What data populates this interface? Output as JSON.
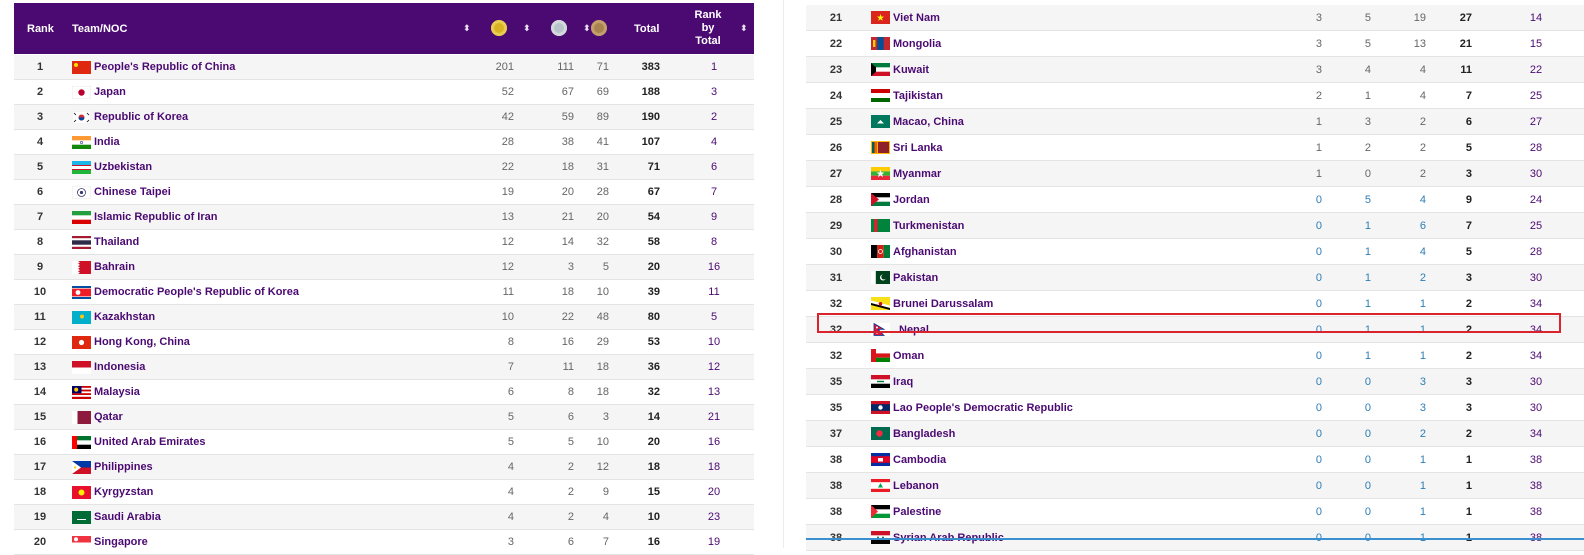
{
  "header": {
    "rank": "Rank",
    "team": "Team/NOC",
    "total": "Total",
    "rank_by_total": [
      "Rank",
      "by",
      "Total"
    ],
    "sort_glyph": "⬍"
  },
  "colors": {
    "header_bg": "#4b0a72",
    "team_text": "#4b0a72",
    "highlight": "#d9232d",
    "zero_medal": "#2d7db4"
  },
  "left_rows": [
    {
      "rank": "1",
      "team": "People's Republic of China",
      "flag": "china",
      "g": "201",
      "s": "111",
      "b": "71",
      "total": "383",
      "rbt": "1"
    },
    {
      "rank": "2",
      "team": "Japan",
      "flag": "japan",
      "g": "52",
      "s": "67",
      "b": "69",
      "total": "188",
      "rbt": "3"
    },
    {
      "rank": "3",
      "team": "Republic of Korea",
      "flag": "korea",
      "g": "42",
      "s": "59",
      "b": "89",
      "total": "190",
      "rbt": "2"
    },
    {
      "rank": "4",
      "team": "India",
      "flag": "india",
      "g": "28",
      "s": "38",
      "b": "41",
      "total": "107",
      "rbt": "4"
    },
    {
      "rank": "5",
      "team": "Uzbekistan",
      "flag": "uzbekistan",
      "g": "22",
      "s": "18",
      "b": "31",
      "total": "71",
      "rbt": "6"
    },
    {
      "rank": "6",
      "team": "Chinese Taipei",
      "flag": "taipei",
      "g": "19",
      "s": "20",
      "b": "28",
      "total": "67",
      "rbt": "7"
    },
    {
      "rank": "7",
      "team": "Islamic Republic of Iran",
      "flag": "iran",
      "g": "13",
      "s": "21",
      "b": "20",
      "total": "54",
      "rbt": "9"
    },
    {
      "rank": "8",
      "team": "Thailand",
      "flag": "thailand",
      "g": "12",
      "s": "14",
      "b": "32",
      "total": "58",
      "rbt": "8"
    },
    {
      "rank": "9",
      "team": "Bahrain",
      "flag": "bahrain",
      "g": "12",
      "s": "3",
      "b": "5",
      "total": "20",
      "rbt": "16"
    },
    {
      "rank": "10",
      "team": "Democratic People's Republic of Korea",
      "flag": "dprk",
      "g": "11",
      "s": "18",
      "b": "10",
      "total": "39",
      "rbt": "11"
    },
    {
      "rank": "11",
      "team": "Kazakhstan",
      "flag": "kazakhstan",
      "g": "10",
      "s": "22",
      "b": "48",
      "total": "80",
      "rbt": "5"
    },
    {
      "rank": "12",
      "team": "Hong Kong, China",
      "flag": "hongkong",
      "g": "8",
      "s": "16",
      "b": "29",
      "total": "53",
      "rbt": "10"
    },
    {
      "rank": "13",
      "team": "Indonesia",
      "flag": "indonesia",
      "g": "7",
      "s": "11",
      "b": "18",
      "total": "36",
      "rbt": "12"
    },
    {
      "rank": "14",
      "team": "Malaysia",
      "flag": "malaysia",
      "g": "6",
      "s": "8",
      "b": "18",
      "total": "32",
      "rbt": "13"
    },
    {
      "rank": "15",
      "team": "Qatar",
      "flag": "qatar",
      "g": "5",
      "s": "6",
      "b": "3",
      "total": "14",
      "rbt": "21"
    },
    {
      "rank": "16",
      "team": "United Arab Emirates",
      "flag": "uae",
      "g": "5",
      "s": "5",
      "b": "10",
      "total": "20",
      "rbt": "16"
    },
    {
      "rank": "17",
      "team": "Philippines",
      "flag": "philippines",
      "g": "4",
      "s": "2",
      "b": "12",
      "total": "18",
      "rbt": "18"
    },
    {
      "rank": "18",
      "team": "Kyrgyzstan",
      "flag": "kyrgyzstan",
      "g": "4",
      "s": "2",
      "b": "9",
      "total": "15",
      "rbt": "20"
    },
    {
      "rank": "19",
      "team": "Saudi Arabia",
      "flag": "saudi",
      "g": "4",
      "s": "2",
      "b": "4",
      "total": "10",
      "rbt": "23"
    },
    {
      "rank": "20",
      "team": "Singapore",
      "flag": "singapore",
      "g": "3",
      "s": "6",
      "b": "7",
      "total": "16",
      "rbt": "19"
    }
  ],
  "right_rows": [
    {
      "rank": "21",
      "team": "Viet Nam",
      "flag": "vietnam",
      "g": "3",
      "s": "5",
      "b": "19",
      "total": "27",
      "rbt": "14"
    },
    {
      "rank": "22",
      "team": "Mongolia",
      "flag": "mongolia",
      "g": "3",
      "s": "5",
      "b": "13",
      "total": "21",
      "rbt": "15"
    },
    {
      "rank": "23",
      "team": "Kuwait",
      "flag": "kuwait",
      "g": "3",
      "s": "4",
      "b": "4",
      "total": "11",
      "rbt": "22"
    },
    {
      "rank": "24",
      "team": "Tajikistan",
      "flag": "tajikistan",
      "g": "2",
      "s": "1",
      "b": "4",
      "total": "7",
      "rbt": "25"
    },
    {
      "rank": "25",
      "team": "Macao, China",
      "flag": "macao",
      "g": "1",
      "s": "3",
      "b": "2",
      "total": "6",
      "rbt": "27"
    },
    {
      "rank": "26",
      "team": "Sri Lanka",
      "flag": "srilanka",
      "g": "1",
      "s": "2",
      "b": "2",
      "total": "5",
      "rbt": "28"
    },
    {
      "rank": "27",
      "team": "Myanmar",
      "flag": "myanmar",
      "g": "1",
      "s": "0",
      "b": "2",
      "total": "3",
      "rbt": "30"
    },
    {
      "rank": "28",
      "team": "Jordan",
      "flag": "jordan",
      "g": "0",
      "s": "5",
      "b": "4",
      "total": "9",
      "rbt": "24"
    },
    {
      "rank": "29",
      "team": "Turkmenistan",
      "flag": "turkmenistan",
      "g": "0",
      "s": "1",
      "b": "6",
      "total": "7",
      "rbt": "25"
    },
    {
      "rank": "30",
      "team": "Afghanistan",
      "flag": "afghanistan",
      "g": "0",
      "s": "1",
      "b": "4",
      "total": "5",
      "rbt": "28"
    },
    {
      "rank": "31",
      "team": "Pakistan",
      "flag": "pakistan",
      "g": "0",
      "s": "1",
      "b": "2",
      "total": "3",
      "rbt": "30"
    },
    {
      "rank": "32",
      "team": "Brunei Darussalam",
      "flag": "brunei",
      "g": "0",
      "s": "1",
      "b": "1",
      "total": "2",
      "rbt": "34"
    },
    {
      "rank": "32",
      "team": "Nepal",
      "flag": "nepal",
      "g": "0",
      "s": "1",
      "b": "1",
      "total": "2",
      "rbt": "34",
      "highlighted": true
    },
    {
      "rank": "32",
      "team": "Oman",
      "flag": "oman",
      "g": "0",
      "s": "1",
      "b": "1",
      "total": "2",
      "rbt": "34"
    },
    {
      "rank": "35",
      "team": "Iraq",
      "flag": "iraq",
      "g": "0",
      "s": "0",
      "b": "3",
      "total": "3",
      "rbt": "30"
    },
    {
      "rank": "35",
      "team": "Lao People's Democratic Republic",
      "flag": "laos",
      "g": "0",
      "s": "0",
      "b": "3",
      "total": "3",
      "rbt": "30"
    },
    {
      "rank": "37",
      "team": "Bangladesh",
      "flag": "bangladesh",
      "g": "0",
      "s": "0",
      "b": "2",
      "total": "2",
      "rbt": "34"
    },
    {
      "rank": "38",
      "team": "Cambodia",
      "flag": "cambodia",
      "g": "0",
      "s": "0",
      "b": "1",
      "total": "1",
      "rbt": "38"
    },
    {
      "rank": "38",
      "team": "Lebanon",
      "flag": "lebanon",
      "g": "0",
      "s": "0",
      "b": "1",
      "total": "1",
      "rbt": "38"
    },
    {
      "rank": "38",
      "team": "Palestine",
      "flag": "palestine",
      "g": "0",
      "s": "0",
      "b": "1",
      "total": "1",
      "rbt": "38"
    },
    {
      "rank": "38",
      "team": "Syrian Arab Republic",
      "flag": "syria",
      "g": "0",
      "s": "0",
      "b": "1",
      "total": "1",
      "rbt": "38"
    }
  ]
}
